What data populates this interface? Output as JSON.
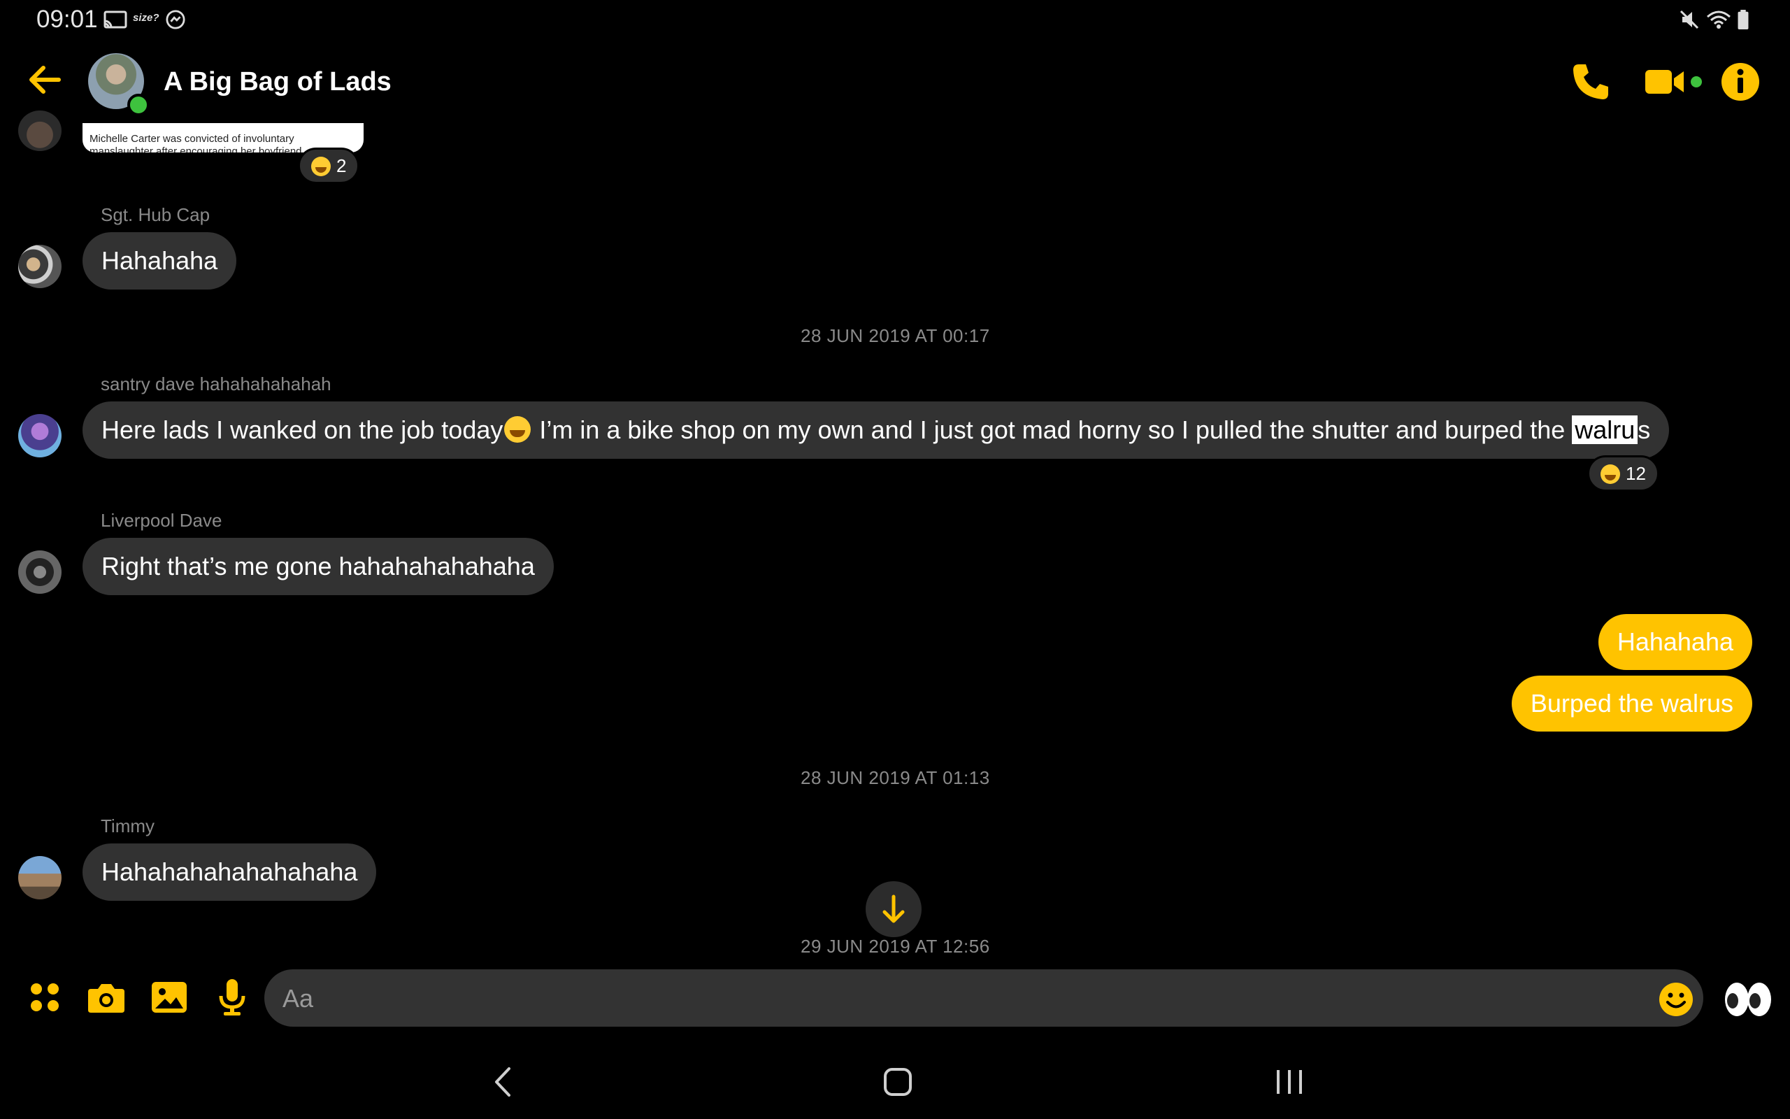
{
  "status_bar": {
    "time": "09:01",
    "app_label": "size?"
  },
  "header": {
    "title": "A Big Bag of Lads"
  },
  "colors": {
    "accent": "#ffc300",
    "online": "#3ec23e",
    "incoming_bubble": "#323232",
    "background": "#000000"
  },
  "top_card": {
    "snippet": "Michelle Carter was convicted of involuntary manslaughter after encouraging her boyfriend",
    "reaction_count": "2"
  },
  "messages": [
    {
      "sender": "Sgt. Hub Cap",
      "text": "Hahahaha"
    },
    {
      "timestamp": "28 JUN 2019 AT 00:17"
    },
    {
      "sender": "santry dave hahahahahahah",
      "text_before": "Here lads I wanked on the job today",
      "text_middle": " I’m in a bike shop on my own and I just got mad horny so I pulled the shutter and burped the ",
      "text_highlight": "walru",
      "text_after": "s",
      "reaction_count": "12"
    },
    {
      "sender": "Liverpool Dave",
      "text": "Right that’s me gone hahahahahahaha"
    },
    {
      "outgoing": true,
      "text": "Hahahaha"
    },
    {
      "outgoing": true,
      "text": "Burped the walrus"
    },
    {
      "timestamp": "28 JUN 2019 AT 01:13"
    },
    {
      "sender": "Timmy",
      "text": "Hahahahahahahahaha"
    },
    {
      "timestamp": "29 JUN 2019 AT 12:56"
    }
  ],
  "composer": {
    "placeholder": "Aa"
  }
}
